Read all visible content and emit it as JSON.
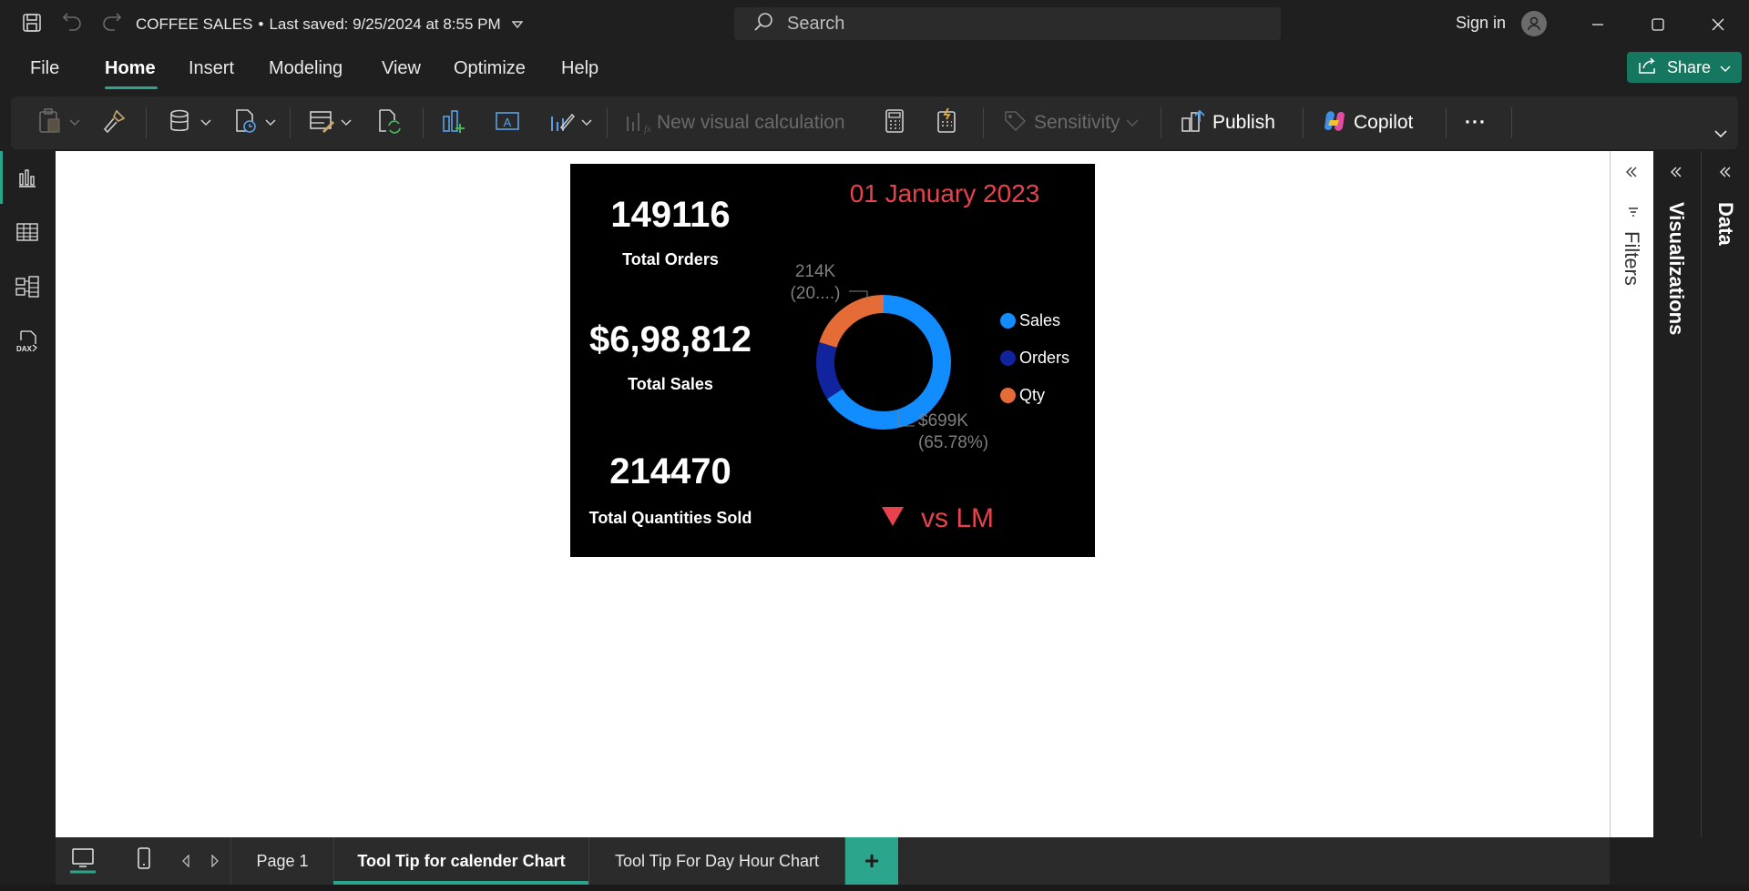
{
  "titlebar": {
    "doc_title": "COFFEE SALES",
    "separator": "•",
    "last_saved": "Last saved: 9/25/2024 at 8:55 PM",
    "search_placeholder": "Search",
    "sign_in": "Sign in"
  },
  "menu": {
    "items": [
      "File",
      "Home",
      "Insert",
      "Modeling",
      "View",
      "Optimize",
      "Help"
    ],
    "active": "Home",
    "share_label": "Share"
  },
  "ribbon": {
    "new_visual_calculation": "New visual calculation",
    "sensitivity": "Sensitivity",
    "publish": "Publish",
    "copilot": "Copilot",
    "more": "···"
  },
  "visual": {
    "date": "01 January 2023",
    "kpis": [
      {
        "value": "149116",
        "label": "Total Orders"
      },
      {
        "value": "$6,98,812",
        "label": "Total Sales"
      },
      {
        "value": "214470",
        "label": "Total Quantities Sold"
      }
    ],
    "donut_labels": {
      "qty_value": "214K",
      "qty_pct": "(20....)",
      "sales_value": "$699K",
      "sales_pct": "(65.78%)"
    },
    "legend": [
      {
        "name": "Sales",
        "color": "#118dff"
      },
      {
        "name": "Orders",
        "color": "#12239e"
      },
      {
        "name": "Qty",
        "color": "#e66c37"
      }
    ],
    "vs_label": "vs LM",
    "trend_color": "#e8424f"
  },
  "chart_data": {
    "type": "pie",
    "series": [
      {
        "name": "Sales",
        "share_pct": 65.78,
        "value_label": "$699K"
      },
      {
        "name": "Orders",
        "share_pct": 14.0
      },
      {
        "name": "Qty",
        "share_pct": 20.2,
        "value_label": "214K"
      }
    ],
    "legend_position": "right"
  },
  "side_panels": {
    "filters": "Filters",
    "visualizations": "Visualizations",
    "data": "Data"
  },
  "tabs": {
    "items": [
      "Page 1",
      "Tool Tip for calender Chart",
      "Tool Tip For Day Hour Chart"
    ],
    "active": "Tool Tip for calender Chart",
    "add": "+"
  },
  "colors": {
    "accent": "#2ca58d",
    "background": "#1f1f1f",
    "canvas": "#ffffff"
  }
}
